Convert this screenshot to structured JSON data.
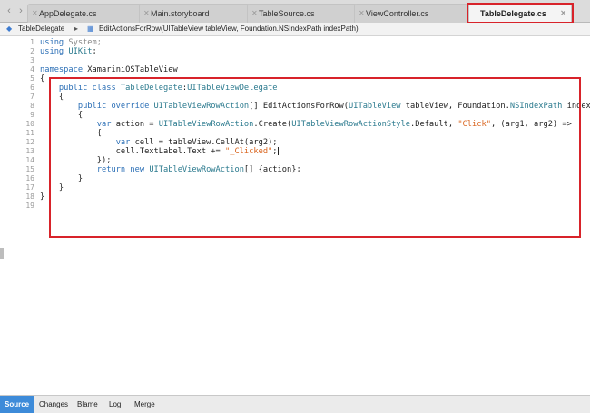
{
  "tabs": [
    {
      "label": "AppDelegate.cs",
      "close": "✕"
    },
    {
      "label": "Main.storyboard",
      "close": "✕"
    },
    {
      "label": "TableSource.cs",
      "close": "✕"
    },
    {
      "label": "ViewController.cs",
      "close": "✕"
    },
    {
      "label": "TableDelegate.cs",
      "close": "✕"
    }
  ],
  "nav": {
    "back": "‹",
    "forward": "›"
  },
  "breadcrumb": {
    "class_icon": "◆",
    "class_name": "TableDelegate",
    "separator": "▸",
    "method_icon": "▦",
    "method_signature": "EditActionsForRow(UITableView tableView, Foundation.NSIndexPath indexPath)"
  },
  "lines": [
    {
      "n": "1",
      "parts": [
        [
          "kw",
          "using"
        ],
        [
          "gr",
          " System;"
        ]
      ]
    },
    {
      "n": "2",
      "parts": [
        [
          "kw",
          "using"
        ],
        [
          "",
          ""
        ],
        [
          "ty",
          " UIKit"
        ],
        [
          "",
          ";"
        ]
      ]
    },
    {
      "n": "3",
      "parts": []
    },
    {
      "n": "4",
      "parts": [
        [
          "kw",
          "namespace"
        ],
        [
          "",
          " XamariniOSTableView"
        ]
      ]
    },
    {
      "n": "5",
      "parts": [
        [
          "",
          "{"
        ]
      ]
    },
    {
      "n": "6",
      "parts": [
        [
          "",
          "    "
        ],
        [
          "kw",
          "public class"
        ],
        [
          "",
          " "
        ],
        [
          "ty",
          "TableDelegate"
        ],
        [
          "",
          ":"
        ],
        [
          "ty",
          "UITableViewDelegate"
        ]
      ]
    },
    {
      "n": "7",
      "parts": [
        [
          "",
          "    {"
        ]
      ]
    },
    {
      "n": "8",
      "parts": [
        [
          "",
          "        "
        ],
        [
          "kw",
          "public override"
        ],
        [
          "",
          " "
        ],
        [
          "ty",
          "UITableViewRowAction"
        ],
        [
          "",
          "[] EditActionsForRow("
        ],
        [
          "ty",
          "UITableView"
        ],
        [
          "",
          " tableView, Foundation."
        ],
        [
          "ty",
          "NSIndexPath"
        ],
        [
          "",
          " indexPath)"
        ]
      ]
    },
    {
      "n": "9",
      "parts": [
        [
          "",
          "        {"
        ]
      ]
    },
    {
      "n": "10",
      "parts": [
        [
          "",
          "            "
        ],
        [
          "kw",
          "var"
        ],
        [
          "",
          " action = "
        ],
        [
          "ty",
          "UITableViewRowAction"
        ],
        [
          "",
          ".Create("
        ],
        [
          "ty",
          "UITableViewRowActionStyle"
        ],
        [
          "",
          ".Default, "
        ],
        [
          "st",
          "\"Click\""
        ],
        [
          "",
          ", (arg1, arg2) =>"
        ]
      ]
    },
    {
      "n": "11",
      "parts": [
        [
          "",
          "            {"
        ]
      ]
    },
    {
      "n": "12",
      "parts": [
        [
          "",
          "                "
        ],
        [
          "kw",
          "var"
        ],
        [
          "",
          " cell = tableView.CellAt(arg2);"
        ]
      ]
    },
    {
      "n": "13",
      "parts": [
        [
          "",
          "                cell.TextLabel.Text += "
        ],
        [
          "st",
          "\"_Clicked\""
        ],
        [
          "",
          ";"
        ],
        [
          "cursor",
          ""
        ]
      ]
    },
    {
      "n": "14",
      "parts": [
        [
          "",
          "            });"
        ]
      ]
    },
    {
      "n": "15",
      "parts": [
        [
          "",
          "            "
        ],
        [
          "kw",
          "return new"
        ],
        [
          "",
          " "
        ],
        [
          "ty",
          "UITableViewRowAction"
        ],
        [
          "",
          "[] {action};"
        ]
      ]
    },
    {
      "n": "16",
      "parts": [
        [
          "",
          "        }"
        ]
      ]
    },
    {
      "n": "17",
      "parts": [
        [
          "",
          "    }"
        ]
      ]
    },
    {
      "n": "18",
      "parts": [
        [
          "",
          "}"
        ]
      ]
    },
    {
      "n": "19",
      "parts": []
    }
  ],
  "bottom_tabs": [
    "Source",
    "Changes",
    "Blame",
    "Log",
    "Merge"
  ],
  "colors": {
    "highlight": "#d8232a",
    "keyword": "#2b6fb6",
    "type": "#2b7a8e",
    "string": "#d9631c",
    "active_tab": "#3d8bd9"
  }
}
